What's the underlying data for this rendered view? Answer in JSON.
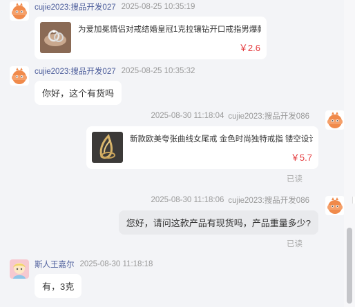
{
  "colors": {
    "link_name": "#4a5b9a",
    "timestamp": "#999999",
    "price": "#e4393c",
    "bubble_self": "#e9eaed",
    "bubble_other": "#ffffff"
  },
  "messages": [
    {
      "sender": "cujie2023:搜品开发027",
      "time": "2025-08-25 10:35:19",
      "avatar": "orange-mascot-icon",
      "product": {
        "title": "为爱加冕情侣对戒结婚皇冠1克拉镶钻开口戒指男爆款...",
        "price": "￥2.6"
      }
    },
    {
      "sender": "cujie2023:搜品开发027",
      "time": "2025-08-25 10:35:32",
      "avatar": "orange-mascot-icon",
      "text": "你好，这个有货吗"
    },
    {
      "sender": "cujie2023:搜品开发086",
      "time": "2025-08-30 11:18:04",
      "avatar": "orange-mascot-icon",
      "product": {
        "title": "新款欧美夸张曲线女尾戒 金色时尚独特戒指 镂空设计...",
        "price": "￥5.7"
      },
      "status": "已读"
    },
    {
      "sender": "cujie2023:搜品开发086",
      "time": "2025-08-30 11:18:06",
      "avatar": "orange-mascot-icon",
      "text": "您好，请问这款产品有现货吗，产品重量多少?",
      "status": "已读"
    },
    {
      "sender": "斯人王嘉尔",
      "time": "2025-08-30 11:18:18",
      "avatar": "user-avatar-icon",
      "text": "有，3克"
    }
  ]
}
